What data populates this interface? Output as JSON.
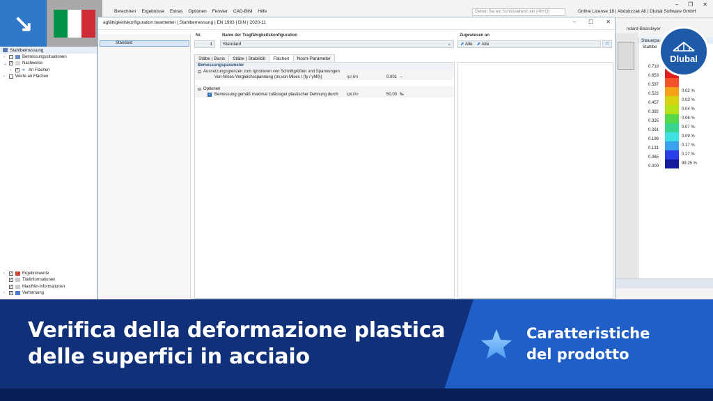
{
  "app": {
    "menu": [
      "Berechnen",
      "Ergebnisse",
      "Extras",
      "Optionen",
      "Fenster",
      "CAD-BIM",
      "Hilfe"
    ],
    "search_placeholder": "Geben Sie ein Schlüsselwort ein (Alt+Q)",
    "license": "Online License 18 | Abdulrzzak Ali | Dlubal Software GmbH",
    "basislayer": "ndard-Basislayer"
  },
  "navigator": {
    "title": "Stahlbemessung",
    "items": [
      {
        "label": "Bemessungssituationen"
      },
      {
        "label": "Nachweise"
      },
      {
        "label": "An Flächen"
      },
      {
        "label": "Werte an Flächen"
      }
    ],
    "bottom_items": [
      {
        "label": "Ergebniswerte"
      },
      {
        "label": "Titelinformationen"
      },
      {
        "label": "Max/Min-Informationen"
      },
      {
        "label": "Verformung"
      }
    ]
  },
  "dialog": {
    "title": "agfähigkeitskonfiguration bearbeiten | Stahlbemessung | EN 1993 | DIN | 2020-11",
    "list_item": "Standard",
    "no_label": "Nr.",
    "no_value": "1",
    "name_label": "Name der Tragfähigkeitskonfiguration",
    "name_value": "Standard",
    "assigned_label": "Zugewiesen an",
    "assigned_a": "Alle",
    "assigned_b": "Alle",
    "tabs": [
      "Stäbe | Basis",
      "Stäbe | Stabilität",
      "Flächen",
      "Norm-Parameter"
    ],
    "section_title": "Bemessungsparameter",
    "group1": "Ausnutzungsgrenzen zum Ignorieren von Schnittgrößen und Spannungen",
    "row1_label": "Von-Mises-Vergleichsspannung (σv,von Mises / (fy / γM0))",
    "row1_symbol": "ησ,lim",
    "row1_value": "0.001",
    "row1_unit": "--",
    "group2": "Optionen",
    "row2_label": "Bemessung gemäß maximal zulässiger plastischer Dehnung durch",
    "row2_symbol": "εpl,lim",
    "row2_value": "50.00",
    "row2_unit": "‰"
  },
  "legend": {
    "head": "Steuerpa",
    "sub": "Stahlbe",
    "rows": [
      {
        "value": "0.718",
        "pct": "",
        "color": "#ffffff"
      },
      {
        "value": "0.653",
        "pct": "",
        "color": "#e21f1f"
      },
      {
        "value": "0.587",
        "pct": "",
        "color": "#f2512a"
      },
      {
        "value": "0.522",
        "pct": "0.02 %",
        "color": "#f5a21a"
      },
      {
        "value": "0.457",
        "pct": "0.03 %",
        "color": "#d8d210"
      },
      {
        "value": "0.392",
        "pct": "0.04 %",
        "color": "#b6e21a"
      },
      {
        "value": "0.326",
        "pct": "0.06 %",
        "color": "#55d94a"
      },
      {
        "value": "0.261",
        "pct": "0.07 %",
        "color": "#38d58f"
      },
      {
        "value": "0.196",
        "pct": "0.09 %",
        "color": "#3fe0e0"
      },
      {
        "value": "0.131",
        "pct": "0.17 %",
        "color": "#3aa2ee"
      },
      {
        "value": "0.065",
        "pct": "0.27 %",
        "color": "#2a3ee8"
      },
      {
        "value": "0.000",
        "pct": "99.25 %",
        "color": "#141b9c"
      }
    ]
  },
  "brand": {
    "name": "Dlubal"
  },
  "banner": {
    "title_line1": "Verifica della deformazione plastica",
    "title_line2": "delle superfici in acciaio",
    "sub_line1": "Caratteristiche",
    "sub_line2": "del prodotto"
  },
  "colors": {
    "flag_green": "#009246",
    "flag_white": "#ffffff",
    "flag_red": "#ce2b37",
    "banner_dark": "#10307a",
    "banner_accent": "#1f5fc7"
  }
}
